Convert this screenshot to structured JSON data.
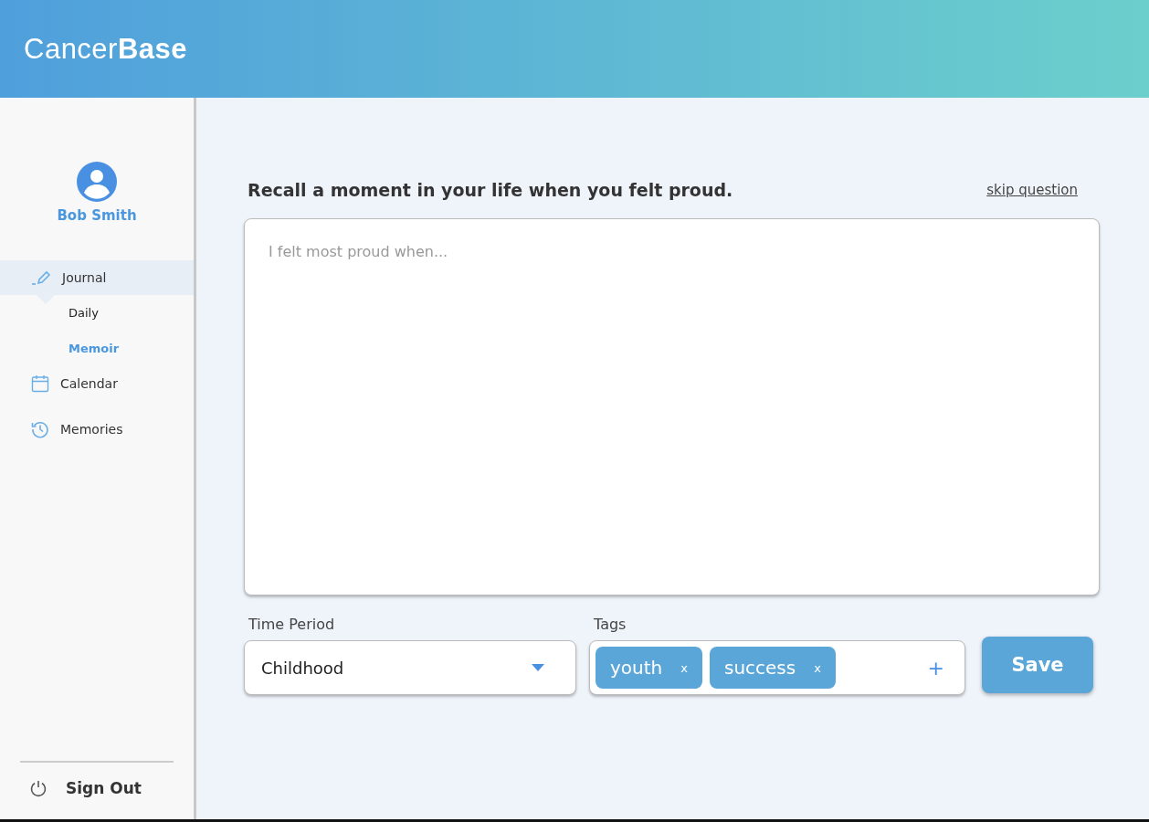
{
  "header": {
    "logo": "Cancer**Base**"
  },
  "user": {
    "name": "Bob Smith"
  },
  "nav": [
    {
      "label": "Journal",
      "kind": "pencil",
      "selected": true,
      "expanded": true,
      "children": [
        {
          "label": "Daily",
          "selected": false
        },
        {
          "label": "Memoir",
          "selected": true
        }
      ]
    },
    {
      "label": "Calendar",
      "kind": "calendar",
      "selected": false
    },
    {
      "label": "Memories",
      "kind": "history",
      "selected": false
    }
  ],
  "sign_out": {
    "label": "Sign Out"
  },
  "prompt": {
    "question": "Recall a moment in your life when you felt proud.",
    "skip": "skip question"
  },
  "entry": {
    "placeholder": "I felt most proud when..."
  },
  "time_period": {
    "label": "Time Period",
    "value": "Childhood"
  },
  "tags": {
    "label": "Tags",
    "items": [
      {
        "text": "youth",
        "remove": "x"
      },
      {
        "text": "success",
        "remove": "x"
      }
    ],
    "add": "+"
  },
  "save": {
    "label": "Save"
  }
}
